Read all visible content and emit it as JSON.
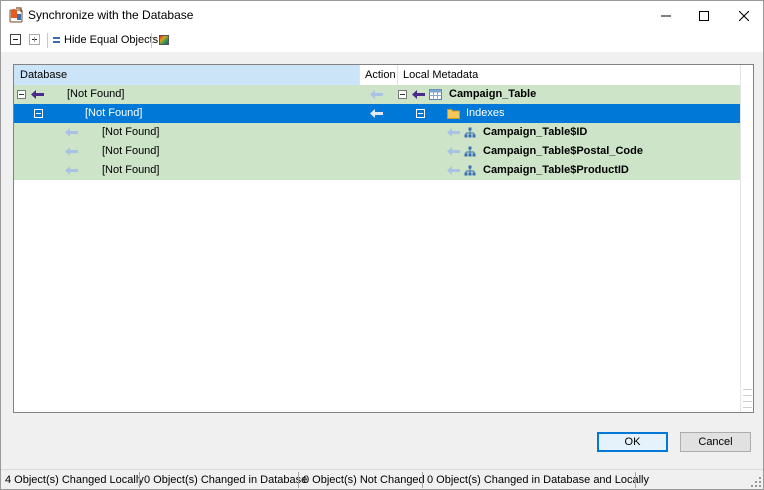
{
  "window": {
    "title": "Synchronize with the Database",
    "icons": {
      "app": "database-sync-icon",
      "minimize": "minimize-icon",
      "maximize": "maximize-icon",
      "close": "close-icon"
    }
  },
  "toolbar": {
    "collapse_icon": "collapse-all-icon",
    "expand_icon": "expand-all-icon",
    "hide_equal_label": "Hide Equal Objects",
    "color_icon": "color-legend-icon"
  },
  "grid": {
    "columns": {
      "database": "Database",
      "action": "Action",
      "local": "Local Metadata"
    },
    "rows": [
      {
        "database": "[Not Found]",
        "local": "Campaign_Table",
        "local_icon": "table-icon",
        "selected": false,
        "level": 0
      },
      {
        "database": "[Not Found]",
        "local": "Indexes",
        "local_icon": "folder-icon",
        "selected": true,
        "level": 1
      },
      {
        "database": "[Not Found]",
        "local": "Campaign_Table$ID",
        "local_icon": "index-icon",
        "selected": false,
        "level": 2
      },
      {
        "database": "[Not Found]",
        "local": "Campaign_Table$Postal_Code",
        "local_icon": "index-icon",
        "selected": false,
        "level": 2
      },
      {
        "database": "[Not Found]",
        "local": "Campaign_Table$ProductID",
        "local_icon": "index-icon",
        "selected": false,
        "level": 2
      }
    ]
  },
  "buttons": {
    "ok": "OK",
    "cancel": "Cancel"
  },
  "status": {
    "changed_locally": "4 Object(s) Changed Locally",
    "changed_in_database": "0 Object(s) Changed in Database",
    "not_changed": "0 Object(s) Not Changed",
    "changed_both": "0 Object(s) Changed in Database and Locally"
  },
  "colors": {
    "row_changed": "#cde4c9",
    "row_selected": "#0078d7",
    "header_selected": "#cce4f7",
    "arrow_active": "#4b2a8a",
    "arrow_inactive": "#a9c3e6"
  }
}
